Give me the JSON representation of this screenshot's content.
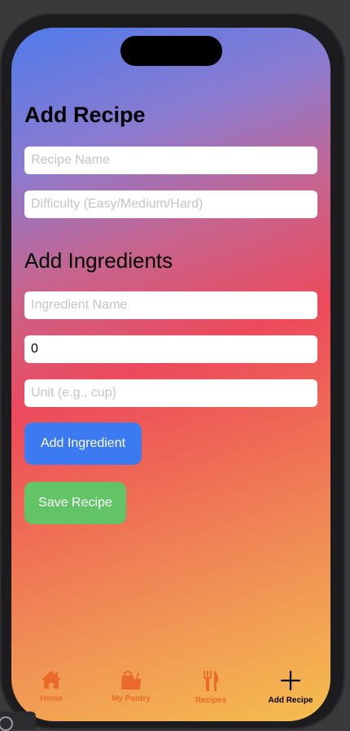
{
  "screen": {
    "title": "Add Recipe",
    "section_title": "Add Ingredients"
  },
  "recipe": {
    "name_placeholder": "Recipe Name",
    "difficulty_placeholder": "Difficulty (Easy/Medium/Hard)"
  },
  "ingredient": {
    "name_placeholder": "Ingredient Name",
    "quantity_value": "0",
    "unit_placeholder": "Unit (e.g., cup)"
  },
  "buttons": {
    "add_ingredient": "Add Ingredient",
    "save_recipe": "Save Recipe"
  },
  "tabs": [
    {
      "label": "Home",
      "icon": "house-icon"
    },
    {
      "label": "My Pantry",
      "icon": "pantry-bag-icon"
    },
    {
      "label": "Recipes",
      "icon": "fork-knife-icon"
    },
    {
      "label": "Add Recipe",
      "icon": "plus-icon",
      "active": true
    }
  ],
  "colors": {
    "accent_blue": "#3b7af0",
    "accent_green": "#62c466",
    "tab_inactive": "#ea6a2a",
    "tab_active": "#000000"
  }
}
